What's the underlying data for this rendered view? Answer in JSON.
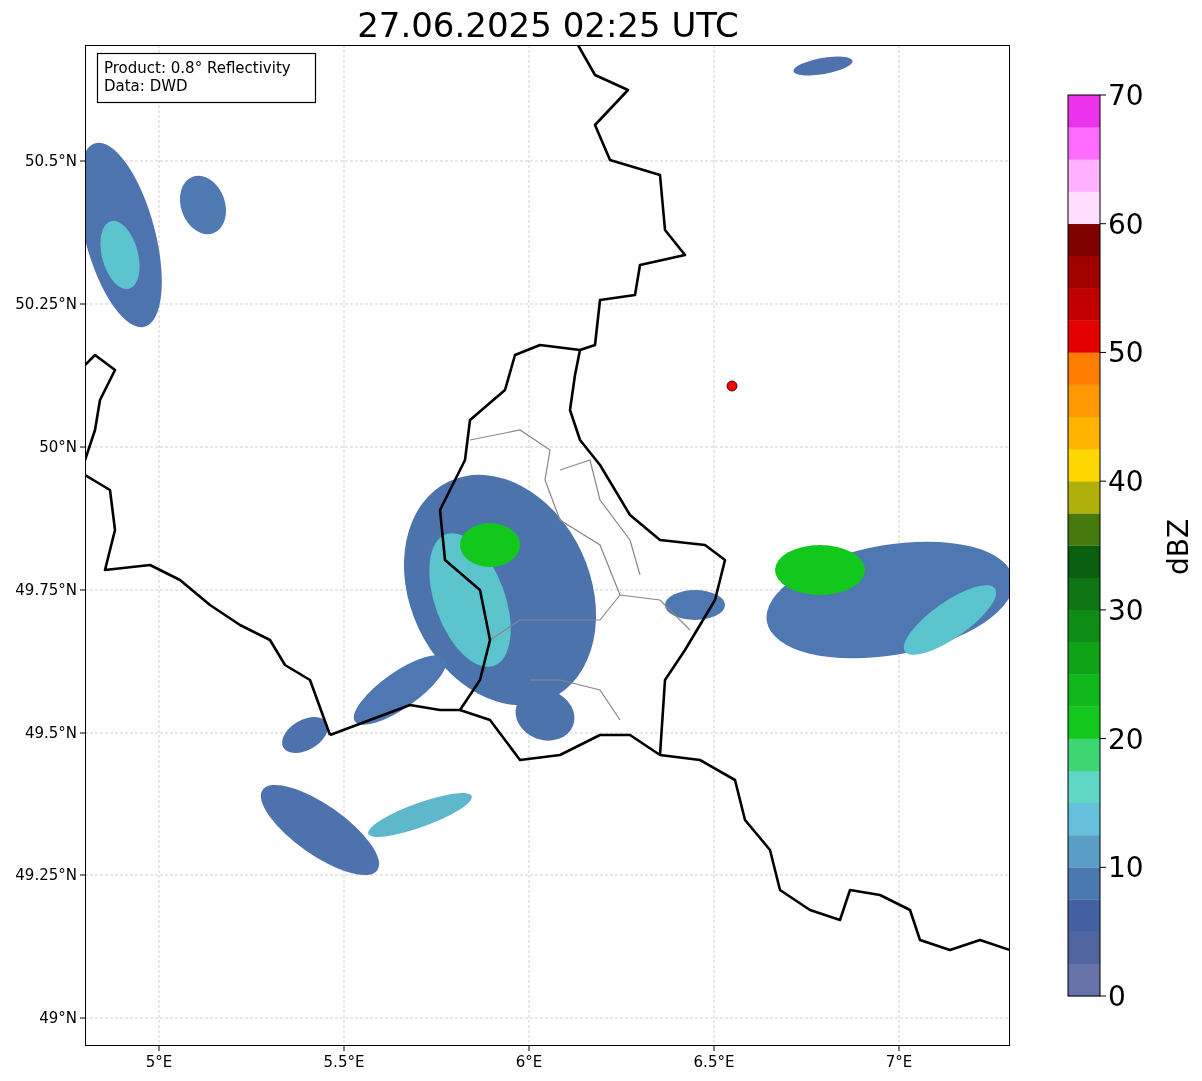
{
  "title": "27.06.2025 02:25 UTC",
  "info_box": {
    "lines": [
      "Product: 0.8° Reflectivity",
      "Data: DWD"
    ]
  },
  "x_ticks": [
    "5°E",
    "5.5°E",
    "6°E",
    "6.5°E",
    "7°E"
  ],
  "y_ticks": [
    "50.5°N",
    "50.25°N",
    "50°N",
    "49.75°N",
    "49.5°N",
    "49.25°N",
    "49°N"
  ],
  "colorbar": {
    "label": "dBZ",
    "ticks": [
      "70",
      "60",
      "50",
      "40",
      "30",
      "20",
      "10",
      "0"
    ],
    "bins": [
      {
        "color": "#6573a8"
      },
      {
        "color": "#5166a0"
      },
      {
        "color": "#4360a3"
      },
      {
        "color": "#4a79b0"
      },
      {
        "color": "#5a9ec8"
      },
      {
        "color": "#66c0db"
      },
      {
        "color": "#60d6c6"
      },
      {
        "color": "#3ed673"
      },
      {
        "color": "#13c81d"
      },
      {
        "color": "#10b81a"
      },
      {
        "color": "#0fa318"
      },
      {
        "color": "#0e8c16"
      },
      {
        "color": "#0d7511"
      },
      {
        "color": "#095f0f"
      },
      {
        "color": "#477a0d"
      },
      {
        "color": "#b0b00a"
      },
      {
        "color": "#ffd700"
      },
      {
        "color": "#ffb400"
      },
      {
        "color": "#ff9800"
      },
      {
        "color": "#ff7d00"
      },
      {
        "color": "#e40000"
      },
      {
        "color": "#c20000"
      },
      {
        "color": "#a00000"
      },
      {
        "color": "#800000"
      },
      {
        "color": "#ffdfff"
      },
      {
        "color": "#ffb1ff"
      },
      {
        "color": "#ff6cff"
      },
      {
        "color": "#ec32ec"
      }
    ]
  }
}
